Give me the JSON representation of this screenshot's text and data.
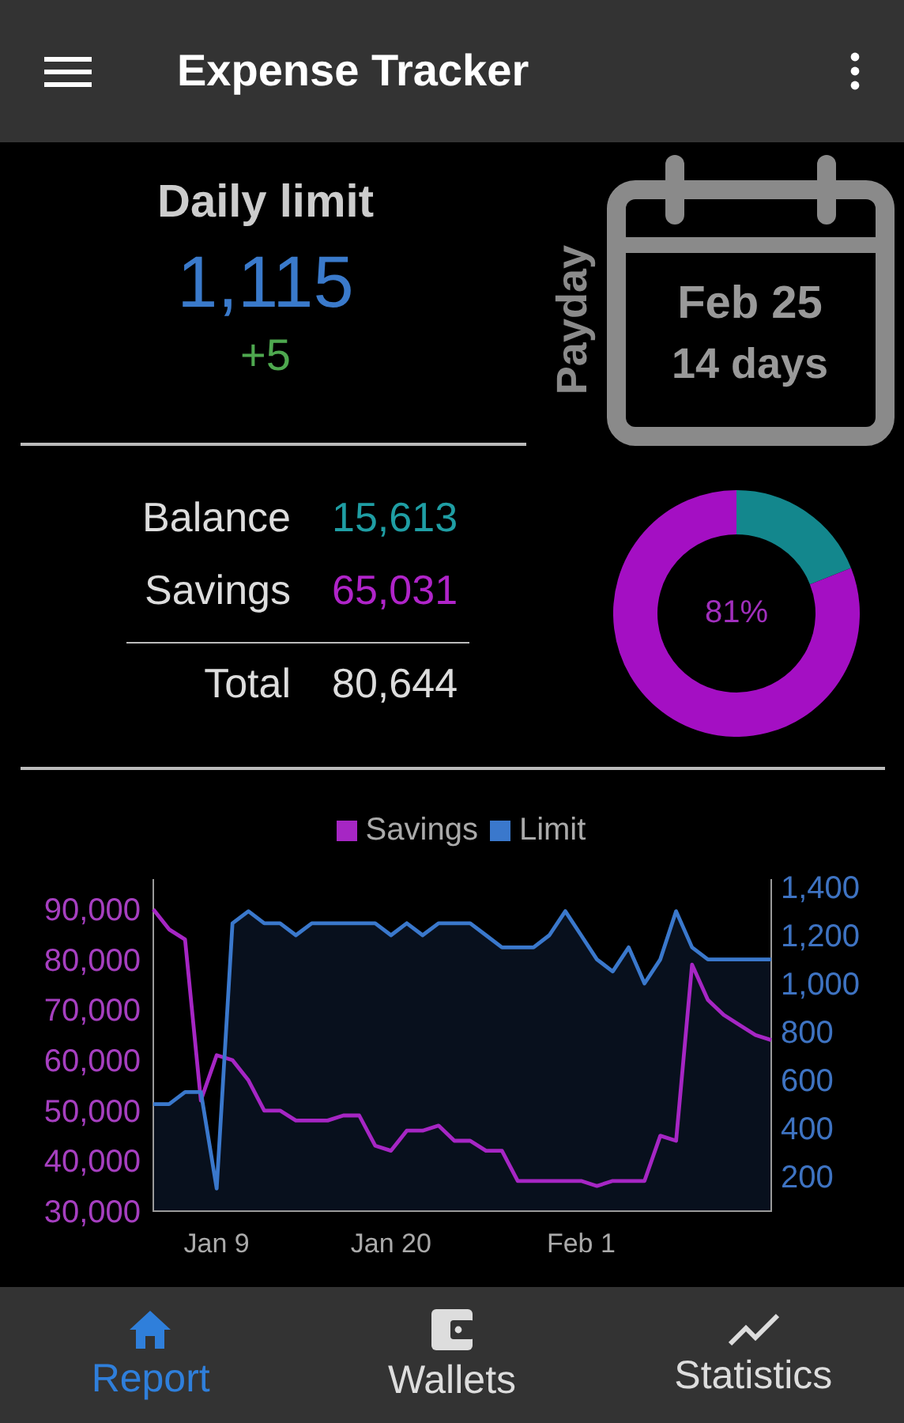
{
  "app_bar": {
    "title": "Expense Tracker"
  },
  "daily": {
    "title": "Daily limit",
    "amount": "1,115",
    "change": "+5"
  },
  "payday": {
    "label": "Payday",
    "date": "Feb 25",
    "days": "14 days"
  },
  "balances": [
    {
      "label": "Balance",
      "value": "15,613",
      "color": "#1f9ea4"
    },
    {
      "label": "Savings",
      "value": "65,031",
      "color": "#b024c9"
    }
  ],
  "total": {
    "label": "Total",
    "value": "80,644"
  },
  "donut": {
    "label": "81%"
  },
  "chart": {
    "chart_data": {
      "type": "line",
      "categories": [
        null,
        null,
        null,
        null,
        "Jan 9",
        null,
        null,
        null,
        null,
        null,
        null,
        null,
        null,
        null,
        null,
        "Jan 20",
        null,
        null,
        null,
        null,
        null,
        null,
        null,
        null,
        null,
        null,
        null,
        "Feb 1",
        null,
        null,
        null,
        null,
        null,
        null,
        null,
        null,
        null,
        null,
        null,
        null
      ],
      "ylim": [
        30000,
        96000
      ],
      "yticks": [
        {
          "value": 30000,
          "label": "30,000"
        },
        {
          "value": 40000,
          "label": "40,000"
        },
        {
          "value": 50000,
          "label": "50,000"
        },
        {
          "value": 60000,
          "label": "60,000"
        },
        {
          "value": 70000,
          "label": "70,000"
        },
        {
          "value": 80000,
          "label": "80,000"
        },
        {
          "value": 90000,
          "label": "90,000"
        }
      ],
      "y2lim": [
        56,
        1433
      ],
      "y2ticks": [
        {
          "value": 200,
          "label": "200"
        },
        {
          "value": 400,
          "label": "400"
        },
        {
          "value": 600,
          "label": "600"
        },
        {
          "value": 800,
          "label": "800"
        },
        {
          "value": 1000,
          "label": "1,000"
        },
        {
          "value": 1200,
          "label": "1,200"
        },
        {
          "value": 1400,
          "label": "1,400"
        }
      ],
      "series": [
        {
          "name": "Savings",
          "color": "#a626c4",
          "values": [
            90000,
            86000,
            84000,
            52000,
            61000,
            60000,
            56000,
            50000,
            50000,
            48000,
            48000,
            48000,
            49000,
            49000,
            43000,
            42000,
            46000,
            46000,
            47000,
            44000,
            44000,
            42000,
            42000,
            36000,
            36000,
            36000,
            36000,
            36000,
            35000,
            36000,
            36000,
            36000,
            45000,
            44000,
            79000,
            72000,
            69000,
            67000,
            65000,
            64000
          ]
        },
        {
          "name": "Limit",
          "color": "#3a78cc",
          "axis": "y2",
          "values": [
            500,
            500,
            550,
            550,
            150,
            1250,
            1300,
            1250,
            1250,
            1200,
            1250,
            1250,
            1250,
            1250,
            1250,
            1200,
            1250,
            1200,
            1250,
            1250,
            1250,
            1200,
            1150,
            1150,
            1150,
            1200,
            1300,
            1200,
            1100,
            1050,
            1150,
            1000,
            1100,
            1300,
            1150,
            1100,
            1100,
            1100,
            1100,
            1100
          ]
        }
      ]
    }
  },
  "nav": [
    {
      "label": "Report",
      "selected": true
    },
    {
      "label": "Wallets",
      "selected": false
    },
    {
      "label": "Statistics",
      "selected": false
    }
  ]
}
